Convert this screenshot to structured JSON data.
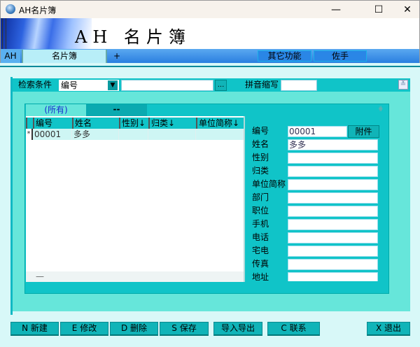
{
  "window": {
    "title": "AH名片簿",
    "min": "—",
    "max": "☐",
    "close": "✕"
  },
  "banner": {
    "title": "AH 名片簿"
  },
  "tabs": [
    {
      "label": "AH"
    },
    {
      "label": "名片簿"
    },
    {
      "label": "+"
    }
  ],
  "top_buttons": {
    "other": "其它功能",
    "assistant": "佐手"
  },
  "search": {
    "label": "检索条件",
    "field_value": "编号",
    "query": "",
    "browse": "...",
    "pinyin_label": "拼音缩写",
    "pinyin_value": "",
    "expand": "≚"
  },
  "grid_tabs": {
    "all": "(所有)",
    "other": "--"
  },
  "grid": {
    "columns": [
      "编号",
      "姓名",
      "性别↓",
      "归类↓",
      "单位简称↓"
    ],
    "rows": [
      {
        "marker": "*",
        "cells": [
          "00001",
          "多多",
          "",
          "",
          ""
        ]
      }
    ],
    "scroll_mark": "—"
  },
  "form": {
    "attach_button": "附件",
    "fields": [
      {
        "label": "编号",
        "value": "00001"
      },
      {
        "label": "姓名",
        "value": "多多"
      },
      {
        "label": "性别",
        "value": ""
      },
      {
        "label": "归类",
        "value": ""
      },
      {
        "label": "单位简称",
        "value": ""
      },
      {
        "label": "部门",
        "value": ""
      },
      {
        "label": "职位",
        "value": ""
      },
      {
        "label": "手机",
        "value": ""
      },
      {
        "label": "电话",
        "value": ""
      },
      {
        "label": "宅电",
        "value": ""
      },
      {
        "label": "传真",
        "value": ""
      },
      {
        "label": "地址",
        "value": ""
      }
    ]
  },
  "buttons": {
    "new": "N 新建",
    "edit": "E 修改",
    "delete": "D 删除",
    "save": "S 保存",
    "import_export": "导入导出",
    "contact": "C 联系",
    "exit": "X 退出"
  }
}
